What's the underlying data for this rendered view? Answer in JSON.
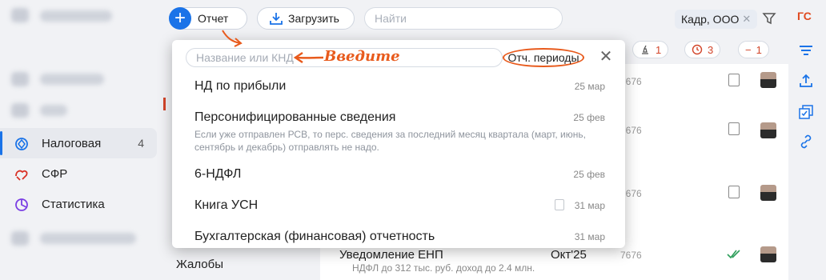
{
  "sidebar": {
    "items": [
      {
        "label": "Налоговая",
        "count": "4"
      },
      {
        "label": "СФР"
      },
      {
        "label": "Статистика"
      }
    ],
    "complaints": "Жалобы"
  },
  "toolbar": {
    "create_label": "Отчет",
    "upload_label": "Загрузить",
    "search_placeholder": "Найти",
    "org_chip": "Кадр, ООО",
    "user_initials": "ГС"
  },
  "filters": {
    "signatures": "1",
    "overdue": "3",
    "errors": "1"
  },
  "dropdown": {
    "search_placeholder": "Название или КНД",
    "hint_label": "Введите",
    "periods_label": "Отч. периоды",
    "items": [
      {
        "title": "НД по прибыли",
        "date": "25 мар"
      },
      {
        "title": "Персонифицированные сведения",
        "date": "25 фев",
        "note": "Если уже отправлен РСВ, то перс. сведения за последний месяц квартала (март, июнь, сентябрь и декабрь) отправлять не надо."
      },
      {
        "title": "6-НДФЛ",
        "date": "25 фев"
      },
      {
        "title": "Книга УСН",
        "date": "31 мар"
      },
      {
        "title": "Бухгалтерская (финансовая) отчетность",
        "date": "31 мар"
      }
    ]
  },
  "list": {
    "code": "7676",
    "last_row": {
      "title": "Уведомление ЕНП",
      "period": "Окт'25",
      "subtitle": "НДФЛ до 312 тыс. руб. доход до 2.4 млн."
    }
  }
}
